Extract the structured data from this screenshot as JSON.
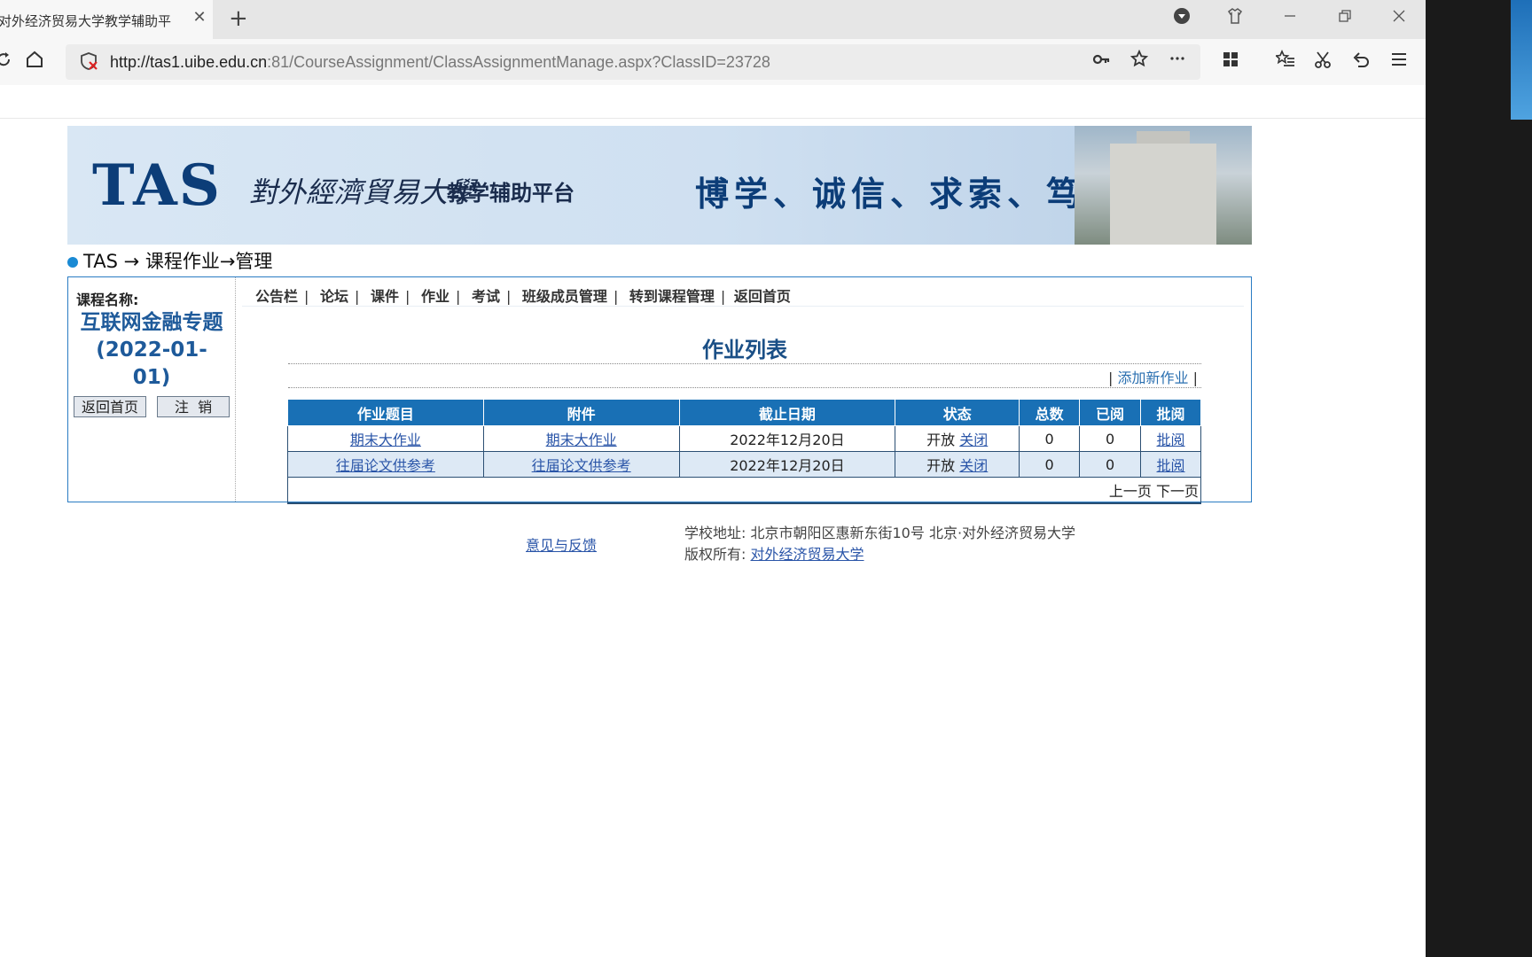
{
  "browser": {
    "tab_title": "对外经济贸易大学教学辅助平",
    "tab_close": "✕",
    "new_tab": "+",
    "url_host": "http://tas1.uibe.edu.cn",
    "url_rest": ":81/CourseAssignment/ClassAssignmentManage.aspx?ClassID=23728"
  },
  "banner": {
    "logo": "TAS",
    "school": "對外經濟貿易大學",
    "platform": "教学辅助平台",
    "motto": "博学、诚信、求索、笃行"
  },
  "breadcrumb": "TAS → 课程作业→管理",
  "sidebar": {
    "course_label": "课程名称:",
    "course_name_line1": "互联网金融专题",
    "course_name_line2": "(2022-01-",
    "course_name_line3": "01)",
    "home_button": "返回首页",
    "logout_button": "注  销"
  },
  "nav": {
    "items": [
      "公告栏",
      "论坛",
      "课件",
      "作业",
      "考试",
      "班级成员管理",
      "转到课程管理",
      "返回首页"
    ],
    "sep": "|"
  },
  "list": {
    "title": "作业列表",
    "add_prefix": "|",
    "add_label": "添加新作业",
    "add_suffix": "|",
    "headers": [
      "作业题目",
      "附件",
      "截止日期",
      "状态",
      "总数",
      "已阅",
      "批阅"
    ],
    "rows": [
      {
        "title": "期末大作业",
        "attachment": "期末大作业",
        "deadline": "2022年12月20日",
        "status": "开放",
        "status_action": "关闭",
        "total": "0",
        "read": "0",
        "review": "批阅"
      },
      {
        "title": "往届论文供参考",
        "attachment": "往届论文供参考",
        "deadline": "2022年12月20日",
        "status": "开放",
        "status_action": "关闭",
        "total": "0",
        "read": "0",
        "review": "批阅"
      }
    ],
    "prev": "上一页",
    "next": "下一页"
  },
  "footer": {
    "feedback": "意见与反馈",
    "address_label": "学校地址:",
    "address": "北京市朝阳区惠新东街10号 北京·对外经济贸易大学",
    "copyright_label": "版权所有:",
    "copyright_link": "对外经济贸易大学"
  }
}
